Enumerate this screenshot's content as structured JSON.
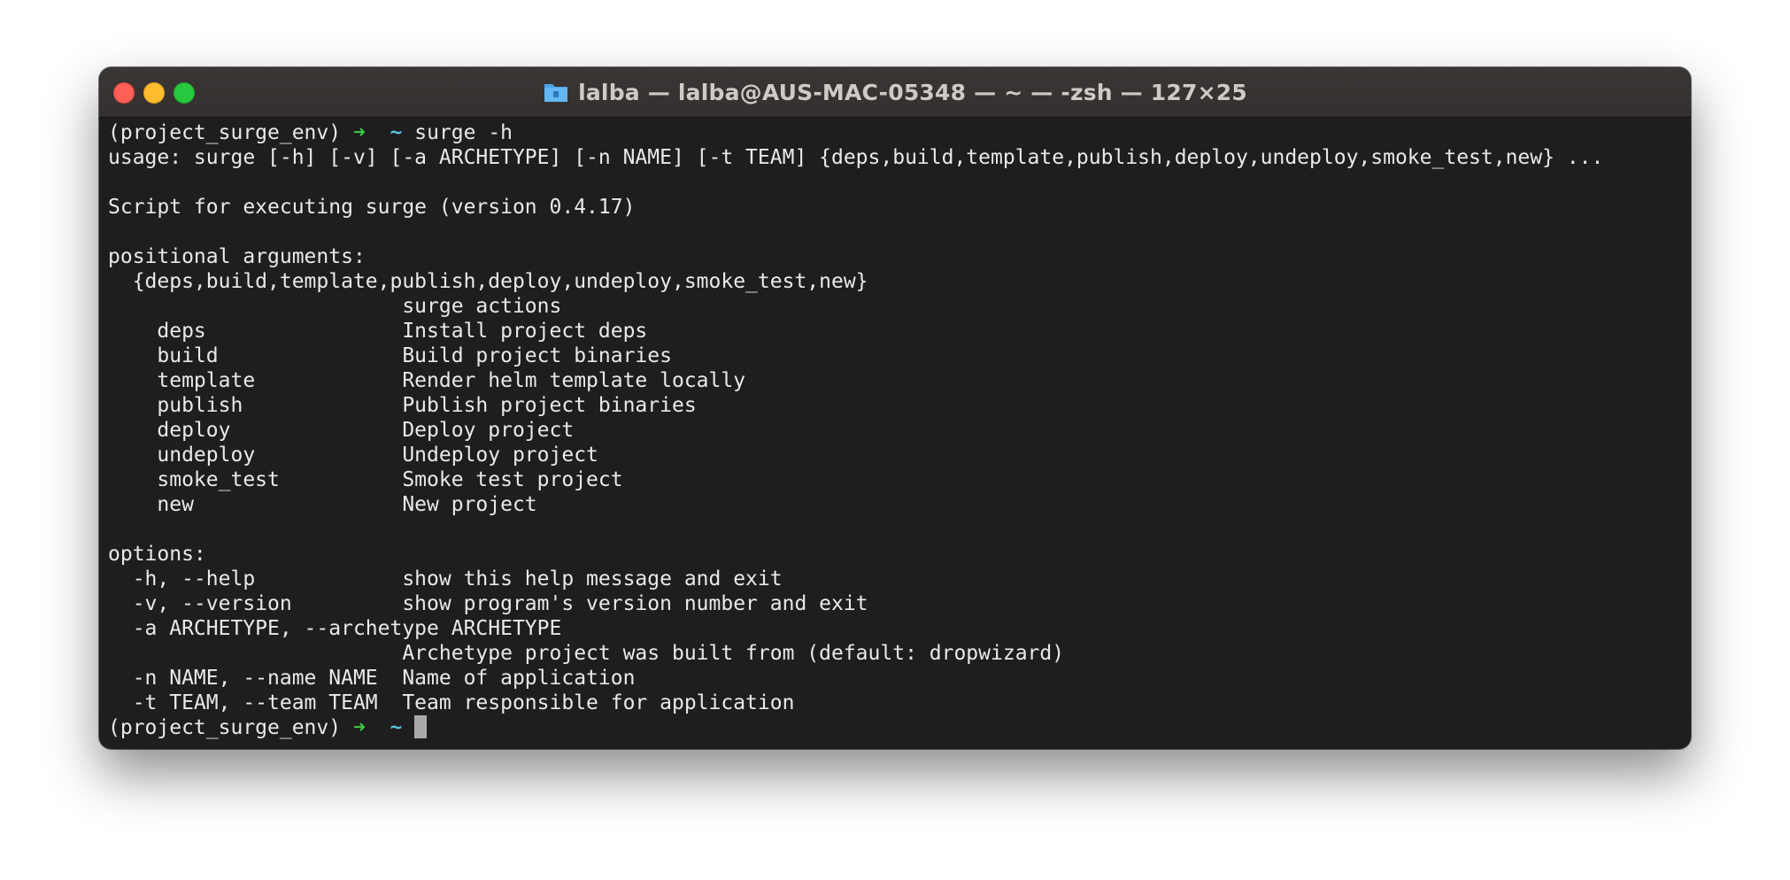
{
  "window": {
    "title": "lalba — lalba@AUS-MAC-05348 — ~ — -zsh — 127×25"
  },
  "prompt": {
    "env": "(project_surge_env)",
    "arrow": "➜",
    "dir": "~",
    "command": "surge -h"
  },
  "output": {
    "usage": "usage: surge [-h] [-v] [-a ARCHETYPE] [-n NAME] [-t TEAM] {deps,build,template,publish,deploy,undeploy,smoke_test,new} ...",
    "description": "Script for executing surge (version 0.4.17)",
    "positional_header": "positional arguments:",
    "positional_choices": "  {deps,build,template,publish,deploy,undeploy,smoke_test,new}",
    "positional_desc": "                        surge actions",
    "actions": [
      "    deps                Install project deps",
      "    build               Build project binaries",
      "    template            Render helm template locally",
      "    publish             Publish project binaries",
      "    deploy              Deploy project",
      "    undeploy            Undeploy project",
      "    smoke_test          Smoke test project",
      "    new                 New project"
    ],
    "options_header": "options:",
    "options": [
      "  -h, --help            show this help message and exit",
      "  -v, --version         show program's version number and exit",
      "  -a ARCHETYPE, --archetype ARCHETYPE",
      "                        Archetype project was built from (default: dropwizard)",
      "  -n NAME, --name NAME  Name of application",
      "  -t TEAM, --team TEAM  Team responsible for application"
    ]
  },
  "colors": {
    "background": "#1e1e1e",
    "text": "#e9e9e9",
    "arrow": "#3ec94a",
    "dir": "#58c2d6",
    "close": "#fe5f57",
    "minimize": "#febc2e",
    "zoom": "#28c840"
  },
  "icons": {
    "title": "folder-icon"
  }
}
